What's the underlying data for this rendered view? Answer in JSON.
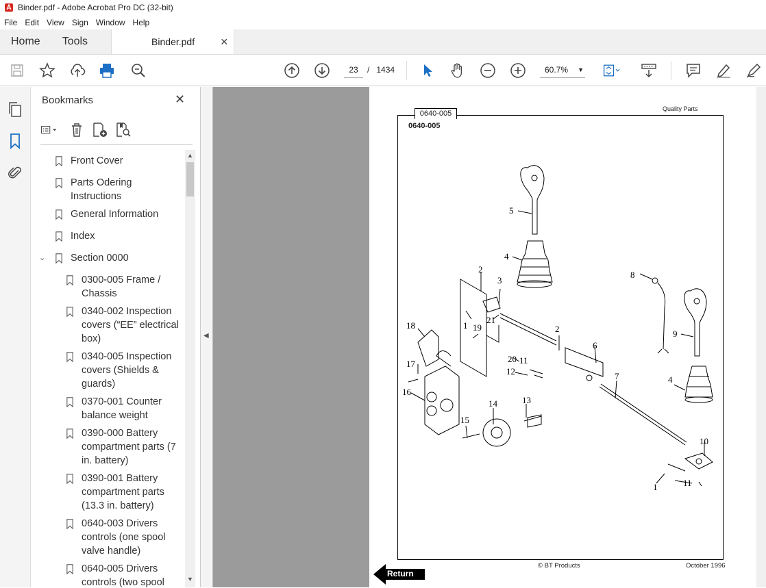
{
  "window": {
    "title": "Binder.pdf - Adobe Acrobat Pro DC (32-bit)"
  },
  "menu": [
    "File",
    "Edit",
    "View",
    "Sign",
    "Window",
    "Help"
  ],
  "tabs": {
    "home": "Home",
    "tools": "Tools",
    "document": "Binder.pdf"
  },
  "toolbar": {
    "current_page": "23",
    "page_separator": "/",
    "total_pages": "1434",
    "zoom": "60.7%"
  },
  "bookmarks": {
    "title": "Bookmarks",
    "items": [
      {
        "label": "Front Cover"
      },
      {
        "label": "Parts Odering Instructions"
      },
      {
        "label": "General Information"
      },
      {
        "label": "Index"
      },
      {
        "label": "Section 0000"
      },
      {
        "label": "0300-005 Frame / Chassis"
      },
      {
        "label": "0340-002 Inspection covers (“EE” electrical box)"
      },
      {
        "label": "0340-005 Inspection covers (Shields & guards)"
      },
      {
        "label": "0370-001 Counter balance weight"
      },
      {
        "label": "0390-000 Battery compartment parts (7 in. battery)"
      },
      {
        "label": "0390-001 Battery compartment parts (13.3 in. battery)"
      },
      {
        "label": "0640-003 Drivers controls (one spool valve handle)"
      },
      {
        "label": "0640-005 Drivers controls (two spool"
      }
    ]
  },
  "document": {
    "tab_label": "0640-005",
    "page_code": "0640-005",
    "header_right": "Quality Parts",
    "footer_center": "© BT Products",
    "footer_right": "October 1996",
    "return_label": "Return",
    "callouts": [
      "5",
      "4",
      "2",
      "3",
      "8",
      "9",
      "1",
      "21",
      "18",
      "19",
      "2",
      "6",
      "20",
      "11",
      "17",
      "12",
      "7",
      "4",
      "16",
      "14",
      "13",
      "15",
      "10",
      "1",
      "11"
    ]
  }
}
